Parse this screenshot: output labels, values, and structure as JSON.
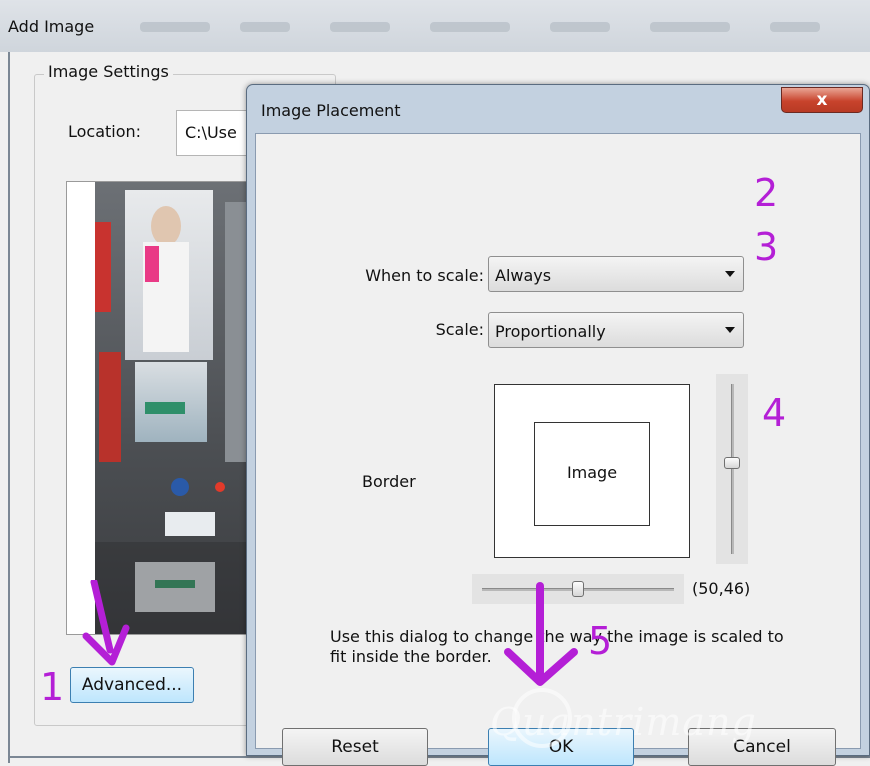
{
  "background_window": {
    "title": "Add Image",
    "group_title": "Image Settings",
    "location_label": "Location:",
    "location_value": "C:\\Use",
    "advanced_label": "Advanced..."
  },
  "dialog": {
    "title": "Image Placement",
    "close_glyph": "x",
    "when_to_scale": {
      "label": "When to scale:",
      "value": "Always"
    },
    "scale": {
      "label": "Scale:",
      "value": "Proportionally"
    },
    "border_label": "Border",
    "preview_image_label": "Image",
    "horizontal_slider_value": 50,
    "vertical_slider_value": 46,
    "coords_readout": "(50,46)",
    "help_text": "Use this dialog to change the way the image is scaled to fit inside the border.",
    "reset_label": "Reset",
    "ok_label": "OK",
    "cancel_label": "Cancel"
  },
  "annotations": {
    "step1": "1",
    "step2": "2",
    "step3": "3",
    "step4": "4",
    "step5": "5",
    "color": "#b41fd6"
  },
  "watermark": "Quantrimang",
  "colors": {
    "accent_button": "#bee6fd",
    "close_button": "#c8432c",
    "dialog_frame": "#c3d1e0"
  }
}
